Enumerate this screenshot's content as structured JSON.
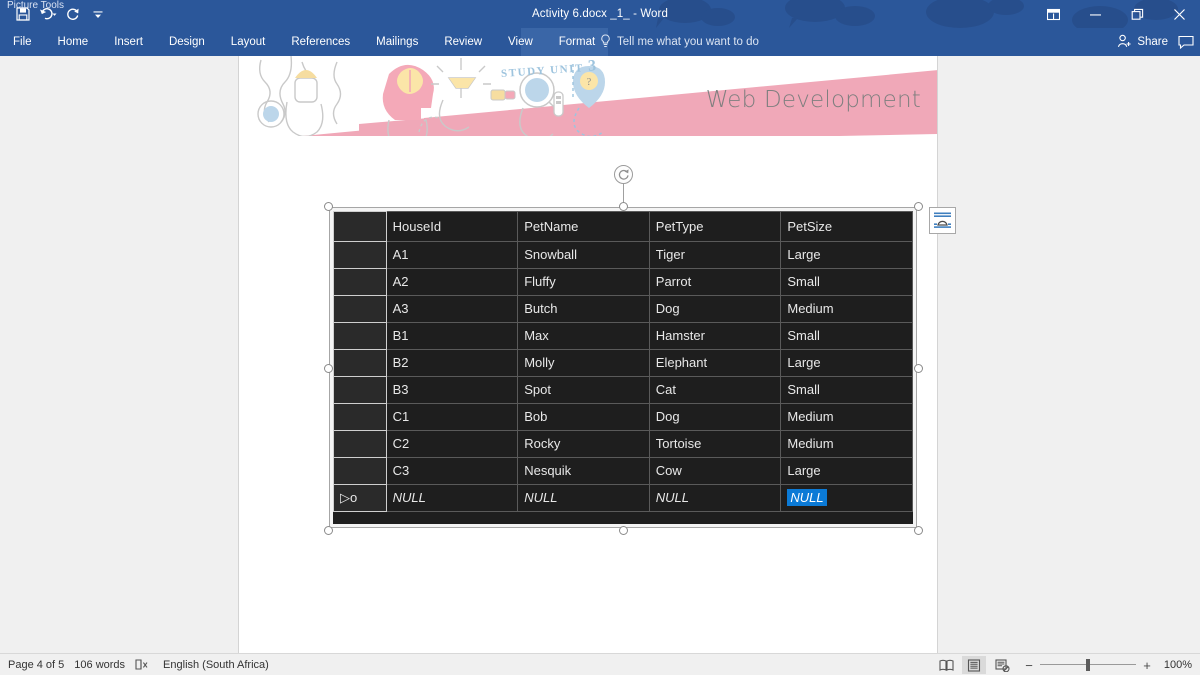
{
  "titlebar": {
    "document_title": "Activity 6.docx _1_ - Word",
    "contextual_group": "Picture Tools",
    "ribbon_display_icon": "ribbon-display-options-icon",
    "minimize_icon": "minimize-icon",
    "restore_icon": "restore-icon",
    "close_icon": "close-icon",
    "qat": [
      {
        "name": "save-icon",
        "label": "Save"
      },
      {
        "name": "undo-icon",
        "label": "Undo"
      },
      {
        "name": "redo-icon",
        "label": "Redo"
      },
      {
        "name": "customize-qat-icon",
        "label": "Customize Quick Access Toolbar"
      }
    ]
  },
  "ribbon": {
    "tabs": [
      {
        "label": "File",
        "active": false
      },
      {
        "label": "Home",
        "active": false
      },
      {
        "label": "Insert",
        "active": false
      },
      {
        "label": "Design",
        "active": false
      },
      {
        "label": "Layout",
        "active": false
      },
      {
        "label": "References",
        "active": false
      },
      {
        "label": "Mailings",
        "active": false
      },
      {
        "label": "Review",
        "active": false
      },
      {
        "label": "View",
        "active": false
      },
      {
        "label": "Format",
        "active": true
      }
    ],
    "tellme": "Tell me what you want to do",
    "tellme_icon": "lightbulb-icon",
    "share_label": "Share",
    "share_icon": "person-add-icon",
    "comments_icon": "comments-icon"
  },
  "document": {
    "banner": {
      "study_unit_prefix": "STUDY UNIT",
      "study_unit_number": "3",
      "title": "Web Development",
      "accent_color": "#f0a8b8",
      "title_color": "#7f7f7f",
      "study_unit_color": "#9ec4de"
    },
    "picture": {
      "alt": "database-table-screenshot",
      "layout_options_icon": "layout-options-icon",
      "rotate_handle_icon": "rotate-icon",
      "new_record_marker": "▷o"
    }
  },
  "chart_data": {
    "type": "table",
    "title": "Pets table (datasheet view)",
    "columns": [
      "HouseId",
      "PetName",
      "PetType",
      "PetSize"
    ],
    "rows": [
      [
        "A1",
        "Snowball",
        "Tiger",
        "Large"
      ],
      [
        "A2",
        "Fluffy",
        "Parrot",
        "Small"
      ],
      [
        "A3",
        "Butch",
        "Dog",
        "Medium"
      ],
      [
        "B1",
        "Max",
        "Hamster",
        "Small"
      ],
      [
        "B2",
        "Molly",
        "Elephant",
        "Large"
      ],
      [
        "B3",
        "Spot",
        "Cat",
        "Small"
      ],
      [
        "C1",
        "Bob",
        "Dog",
        "Medium"
      ],
      [
        "C2",
        "Rocky",
        "Tortoise",
        "Medium"
      ],
      [
        "C3",
        "Nesquik",
        "Cow",
        "Large"
      ],
      [
        "NULL",
        "NULL",
        "NULL",
        "NULL"
      ]
    ],
    "selected_cell": {
      "row": 9,
      "column": 3,
      "value": "NULL"
    },
    "row_count": 10,
    "background": "#1e1e1e",
    "text_color": "#e8e8e8",
    "selection_color": "#0b7ad6"
  },
  "statusbar": {
    "page": "Page 4 of 5",
    "words": "106 words",
    "proofing_icon": "proofing-errors-icon",
    "language": "English (South Africa)",
    "views": [
      {
        "name": "read-mode-view-button",
        "icon": "book-icon",
        "active": false
      },
      {
        "name": "print-layout-view-button",
        "icon": "page-icon",
        "active": true
      },
      {
        "name": "web-layout-view-button",
        "icon": "web-page-icon",
        "active": false
      }
    ],
    "zoom_out_label": "−",
    "zoom_in_label": "+",
    "zoom_level": "100%"
  }
}
